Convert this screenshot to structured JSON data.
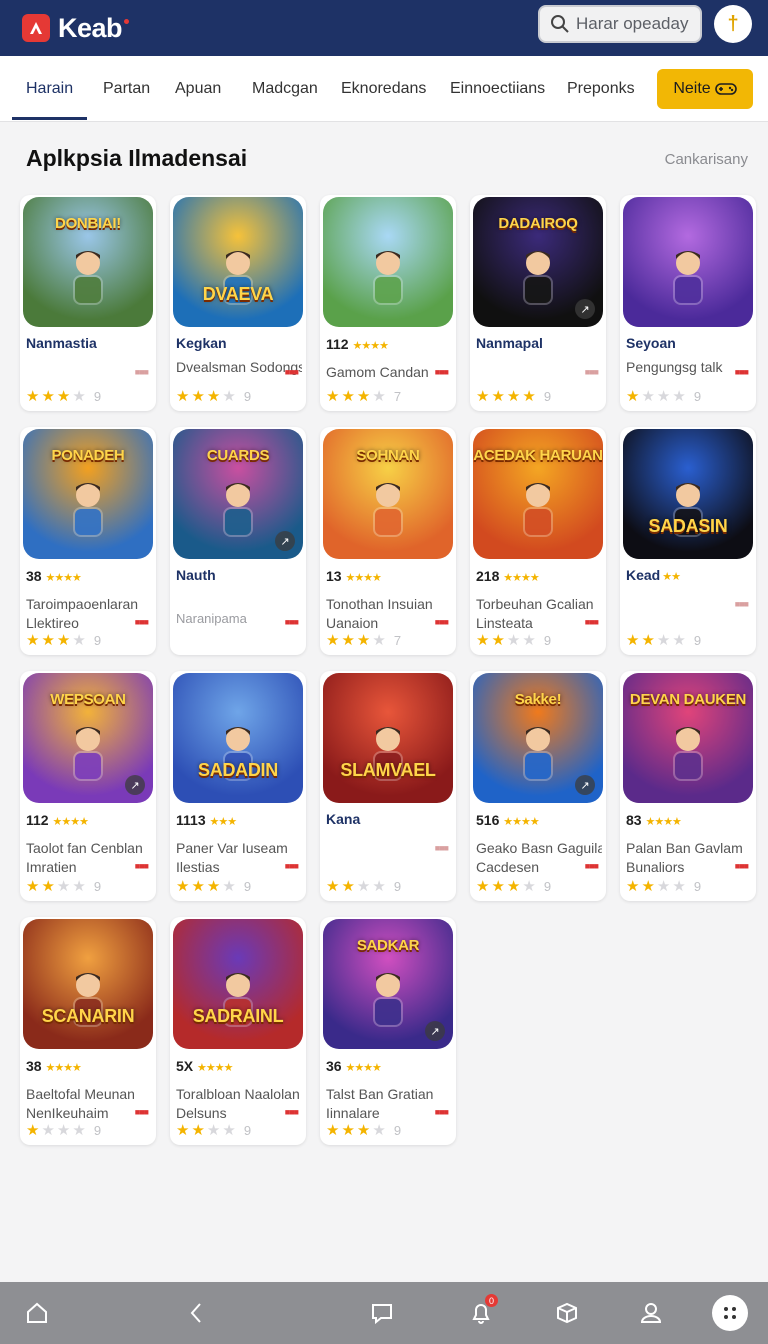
{
  "app": {
    "logo_text": "Keab",
    "search_placeholder": "Harar opeaday",
    "avatar_glyph": "†",
    "accent": "#1e3266",
    "brand_red": "#e53935",
    "cta_color": "#f2b705"
  },
  "tabs": [
    {
      "label": "Harain",
      "active": true
    },
    {
      "label": "Partan",
      "active": false
    },
    {
      "label": "Apuan",
      "active": false
    },
    {
      "label": "Madcgan",
      "active": false
    },
    {
      "label": "Eknoredans",
      "active": false
    },
    {
      "label": "Einnoectiians",
      "active": false
    },
    {
      "label": "Preponks",
      "active": false
    }
  ],
  "cta": {
    "label": "Neite",
    "icon": "gamepad-icon"
  },
  "section": {
    "title": "Aplkpsia Ilmadensai",
    "link": "Cankarisany"
  },
  "cards": [
    {
      "art_title": "DONBIAI!",
      "title_pos": "top",
      "name": "Nanmastia",
      "name_style": "name",
      "sub1": "",
      "sub2": "",
      "rating": 3,
      "rating_count": "9",
      "bg": "#4b7a3a",
      "bg2": "#9ac6e8"
    },
    {
      "art_title": "DVAEVA",
      "title_pos": "bottom",
      "name": "Kegkan",
      "name_style": "name",
      "sub1": "Dvealsman Sodongs",
      "sub2": "",
      "rating": 3,
      "rating_count": "9",
      "bg": "#1d6fb8",
      "bg2": "#f6c23a"
    },
    {
      "art_title": "",
      "title_pos": "top",
      "name": "",
      "name_style": "row",
      "row_num": "112",
      "row_stars": "★★★★",
      "sub1": "Gamom Candan",
      "sub2": "",
      "rating": 3,
      "rating_count": "7",
      "bg": "#5aa14a",
      "bg2": "#a9d8f5"
    },
    {
      "art_title": "DADAIROQ",
      "title_pos": "top",
      "name": "Nanmapal",
      "name_style": "name",
      "sub1": "",
      "sub2": "",
      "rating": 4,
      "rating_count": "9",
      "bg": "#101010",
      "bg2": "#3b2a7a",
      "badge": true
    },
    {
      "art_title": "",
      "title_pos": "top",
      "name": "Seyoan",
      "name_style": "name",
      "sub1": "Pengungsg talk",
      "sub2": "",
      "rating": 1,
      "rating_count": "9",
      "bg": "#4b2a9a",
      "bg2": "#b36ae0"
    },
    {
      "art_title": "PONADEH",
      "title_pos": "top",
      "name": "",
      "name_style": "row",
      "row_num": "38",
      "row_stars": "★★★★",
      "sub1": "Taroimpaoenlaran",
      "sub2": "Llektireo",
      "rating": 3,
      "rating_count": "9",
      "bg": "#2f6fc2",
      "bg2": "#f2a020"
    },
    {
      "art_title": "CUARDS",
      "title_pos": "top",
      "name": "Nauth",
      "name_style": "name",
      "sub1": "",
      "sub2": "Naranipama",
      "sub_faded": true,
      "rating": 0,
      "rating_count": "",
      "bg": "#1a5a8a",
      "bg2": "#c94fa0",
      "badge": true
    },
    {
      "art_title": "SOHNAN",
      "title_pos": "top",
      "name": "",
      "name_style": "row",
      "row_num": "13",
      "row_stars": "★★★★",
      "sub1": "Tonothan Insuian",
      "sub2": "Uanaion",
      "rating": 3,
      "rating_count": "7",
      "bg": "#e0642a",
      "bg2": "#f7d046"
    },
    {
      "art_title": "ACEDAK HARUAN",
      "title_pos": "top",
      "name": "",
      "name_style": "row",
      "row_num": "218",
      "row_stars": "★★★★",
      "sub1": "Torbeuhan Gcalian",
      "sub2": "Linsteata",
      "rating": 2,
      "rating_count": "9",
      "bg": "#d24a1f",
      "bg2": "#f4a623"
    },
    {
      "art_title": "SADASIN",
      "title_pos": "bottom",
      "name": "Kead",
      "name_style": "name",
      "name_stars": "★★",
      "sub1": "",
      "sub2": "",
      "rating": 2,
      "rating_count": "9",
      "bg": "#0d0d14",
      "bg2": "#2a5fd0"
    },
    {
      "art_title": "WEPSOAN",
      "title_pos": "top",
      "name": "",
      "name_style": "row",
      "row_num": "112",
      "row_stars": "★★★★",
      "sub1": "Taolot fan Cenblan",
      "sub2": "Imratien",
      "rating": 2,
      "rating_count": "9",
      "bg": "#7a3ab8",
      "bg2": "#f2b23a",
      "badge": true
    },
    {
      "art_title": "SADADIN",
      "title_pos": "bottom",
      "name": "",
      "name_style": "row",
      "row_num": "1113",
      "row_stars": "★★★",
      "sub1": "Paner Var Iuseam",
      "sub2": "Ilestias",
      "rating": 3,
      "rating_count": "9",
      "bg": "#2d4fb5",
      "bg2": "#6fa5e8"
    },
    {
      "art_title": "SLAMVAEL",
      "title_pos": "bottom",
      "name": "Kana",
      "name_style": "name",
      "sub1": "",
      "sub2": "",
      "rating": 2,
      "rating_count": "9",
      "bg": "#8a1a1a",
      "bg2": "#e8563a"
    },
    {
      "art_title": "Sakke!",
      "title_pos": "top",
      "name": "",
      "name_style": "row",
      "row_num": "516",
      "row_stars": "★★★★",
      "sub1": "Geako Basn Gaguila",
      "sub2": "Cacdesen",
      "rating": 3,
      "rating_count": "9",
      "bg": "#1f63c8",
      "bg2": "#f07a1c",
      "badge": true
    },
    {
      "art_title": "DEVAN DAUKEN",
      "title_pos": "top",
      "name": "",
      "name_style": "row",
      "row_num": "83",
      "row_stars": "★★★★",
      "sub1": "Palan Ban Gavlam",
      "sub2": "Bunaliors",
      "rating": 2,
      "rating_count": "9",
      "bg": "#5b2a8a",
      "bg2": "#e0447a"
    },
    {
      "art_title": "SCANARIN",
      "title_pos": "bottom",
      "name": "",
      "name_style": "row",
      "row_num": "38",
      "row_stars": "★★★★",
      "sub1": "Baeltofal Meunan",
      "sub2": "NenIkeuhaim",
      "rating": 1,
      "rating_count": "9",
      "bg": "#8a2a1a",
      "bg2": "#f0a040"
    },
    {
      "art_title": "SADRAINL",
      "title_pos": "bottom",
      "name": "",
      "name_style": "row",
      "row_num": "5X",
      "row_stars": "★★★★",
      "sub1": "Toralbloan Naalolan",
      "sub2": "Delsuns",
      "rating": 2,
      "rating_count": "9",
      "bg": "#b52a2a",
      "bg2": "#6a3ab8"
    },
    {
      "art_title": "SADKAR",
      "title_pos": "top",
      "name": "",
      "name_style": "row",
      "row_num": "36",
      "row_stars": "★★★★",
      "sub1": "Talst Ban Gratian",
      "sub2": "Iinnalare",
      "rating": 3,
      "rating_count": "9",
      "bg": "#3a2a8a",
      "bg2": "#d04fc0",
      "badge": true
    }
  ],
  "bottom_nav": [
    {
      "icon": "home-icon"
    },
    {
      "icon": "back-icon"
    },
    {
      "icon": "chat-icon"
    },
    {
      "icon": "notification-icon",
      "badge": "0"
    },
    {
      "icon": "box-icon"
    },
    {
      "icon": "profile-icon"
    },
    {
      "icon": "menu-dots-icon"
    }
  ]
}
